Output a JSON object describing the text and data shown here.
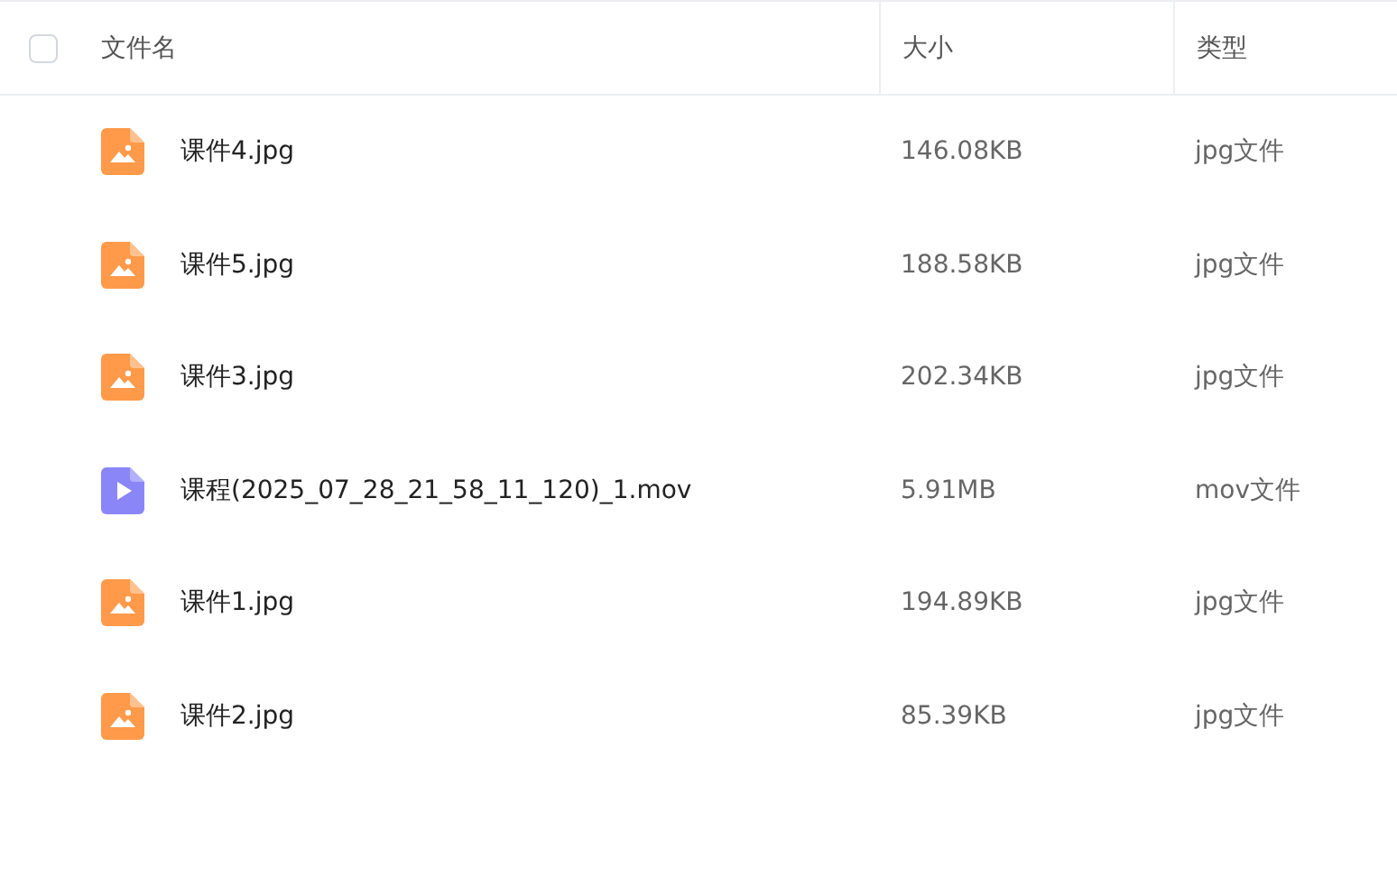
{
  "header": {
    "select_all": {
      "checked": false
    },
    "columns": [
      "文件名",
      "大小",
      "类型"
    ]
  },
  "files": [
    {
      "kind": "image",
      "name": "课件4.jpg",
      "size": "146.08KB",
      "type": "jpg文件"
    },
    {
      "kind": "image",
      "name": "课件5.jpg",
      "size": "188.58KB",
      "type": "jpg文件"
    },
    {
      "kind": "image",
      "name": "课件3.jpg",
      "size": "202.34KB",
      "type": "jpg文件"
    },
    {
      "kind": "video",
      "name": "课程(2025_07_28_21_58_11_120)_1.mov",
      "size": "5.91MB",
      "type": "mov文件"
    },
    {
      "kind": "image",
      "name": "课件1.jpg",
      "size": "194.89KB",
      "type": "jpg文件"
    },
    {
      "kind": "image",
      "name": "课件2.jpg",
      "size": "85.39KB",
      "type": "jpg文件"
    }
  ]
}
